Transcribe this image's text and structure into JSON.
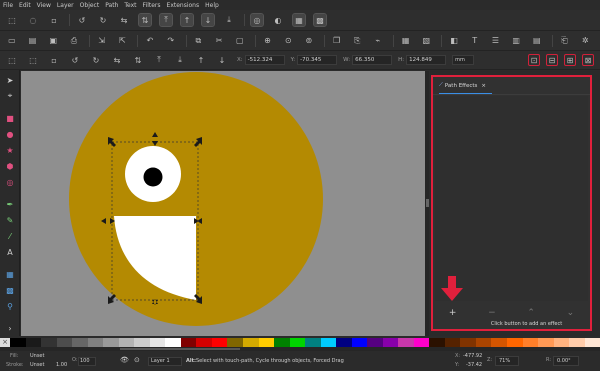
{
  "menu": [
    "File",
    "Edit",
    "View",
    "Layer",
    "Object",
    "Path",
    "Text",
    "Filters",
    "Extensions",
    "Help"
  ],
  "toolbar_coords": {
    "x_label": "X:",
    "x_value": "-512.324",
    "y_label": "Y:",
    "y_value": "-70.345",
    "w_label": "W:",
    "w_value": "66.350",
    "h_label": "H:",
    "h_value": "124.849",
    "unit": "mm"
  },
  "panel": {
    "tab_label": "Path Effects",
    "tab_close": "×",
    "add_button": "+",
    "remove_button": "−",
    "up_button": "⌃",
    "down_button": "⌄",
    "hint": "Click button to add an effect"
  },
  "status": {
    "fill_label": "Fill:",
    "fill_value": "Unset",
    "stroke_label": "Stroke:",
    "stroke_value": "Unset",
    "stroke_width": "1.00",
    "opacity_label": "O:",
    "opacity_value": "100",
    "layer": "Layer 1",
    "message_bold": "Alt:",
    "message": "Select with touch-path, Cycle through objects, Forced Drag",
    "x_label": "X:",
    "x_value": "-477.92",
    "y_label": "Y:",
    "y_value": "-37.42",
    "zoom_label": "Z:",
    "zoom_value": "71%",
    "rotate_label": "R:",
    "rotate_value": "0.00°"
  },
  "colors": {
    "emoji_fill": "#b48a02",
    "canvas_bg": "#8f8f8f",
    "highlight": "#e0203c",
    "tab_accent": "#3a8ee6"
  }
}
